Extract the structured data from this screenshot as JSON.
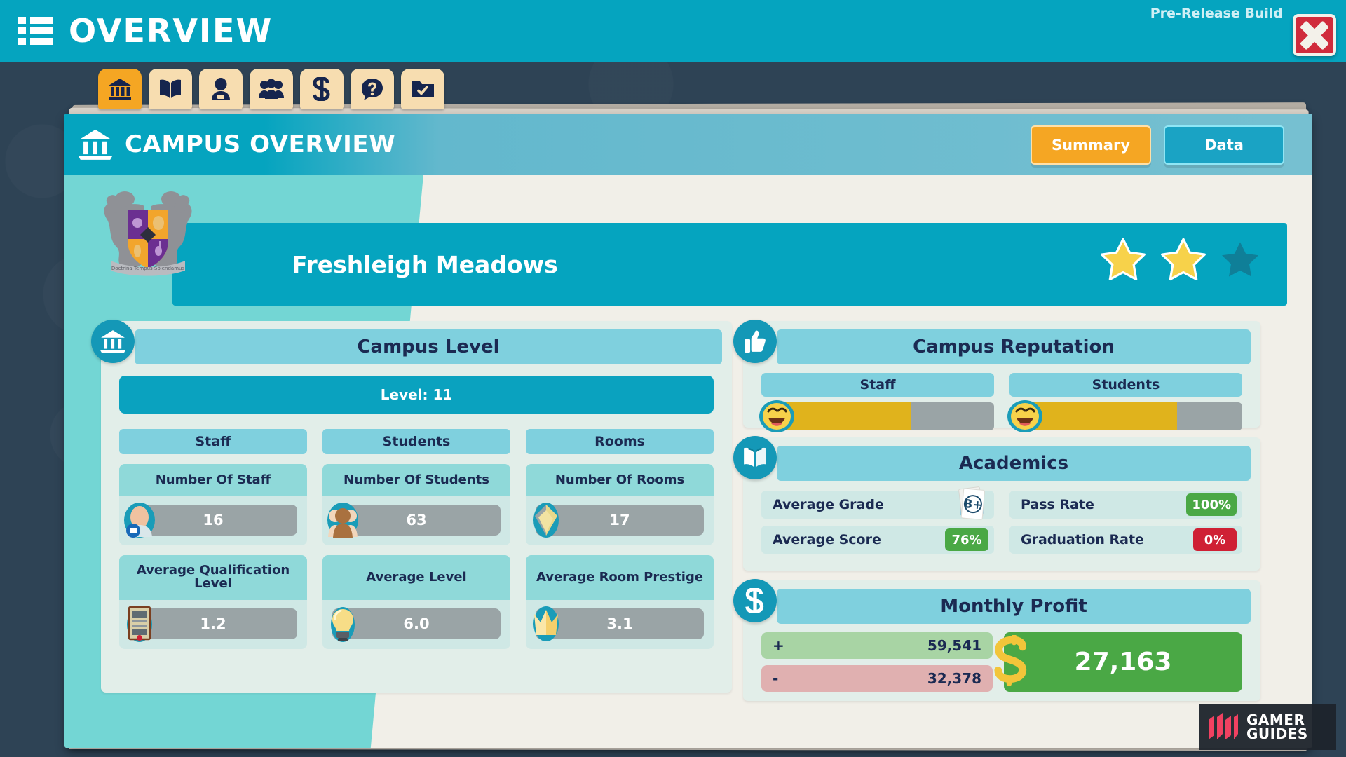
{
  "topbar": {
    "title": "OVERVIEW",
    "prerelease_label": "Pre-Release Build",
    "menu_icon": "list-icon",
    "close_icon": "close-x-icon"
  },
  "tabstrip": {
    "tabs": [
      {
        "name": "campus",
        "icon": "bank-icon",
        "active": true
      },
      {
        "name": "courses",
        "icon": "open-book-icon",
        "active": false
      },
      {
        "name": "staff",
        "icon": "staff-person-icon",
        "active": false
      },
      {
        "name": "students",
        "icon": "students-group-icon",
        "active": false
      },
      {
        "name": "finance",
        "icon": "dollar-icon",
        "active": false
      },
      {
        "name": "help",
        "icon": "question-bubble-icon",
        "active": false
      },
      {
        "name": "objectives",
        "icon": "folder-check-icon",
        "active": false
      }
    ]
  },
  "window": {
    "header": {
      "icon": "bank-icon",
      "title": "CAMPUS OVERVIEW",
      "tabs": [
        {
          "label": "Summary",
          "selected": true
        },
        {
          "label": "Data",
          "selected": false
        }
      ]
    },
    "banner": {
      "crest_icon": "campus-crest-icon",
      "campus_name": "Freshleigh Meadows",
      "stars_total": 3,
      "stars_filled": 2
    },
    "campus_level": {
      "panel_icon": "bank-icon",
      "title": "Campus Level",
      "level_label": "Level: 11",
      "columns": [
        "Staff",
        "Students",
        "Rooms"
      ],
      "stats": [
        {
          "title": "Number Of Staff",
          "value": "16",
          "icon": "staff-avatar-icon",
          "two_line": false
        },
        {
          "title": "Number Of Students",
          "value": "63",
          "icon": "students-avatar-icon",
          "two_line": false
        },
        {
          "title": "Number Of Rooms",
          "value": "17",
          "icon": "room-gem-icon",
          "two_line": false
        },
        {
          "title": "Average Qualification Level",
          "value": "1.2",
          "icon": "certificate-icon",
          "two_line": true
        },
        {
          "title": "Average Level",
          "value": "6.0",
          "icon": "lightbulb-icon",
          "two_line": true
        },
        {
          "title": "Average Room Prestige",
          "value": "3.1",
          "icon": "crown-icon",
          "two_line": true
        }
      ]
    },
    "reputation": {
      "panel_icon": "thumbs-up-icon",
      "title": "Campus Reputation",
      "bars": [
        {
          "label": "Staff",
          "percent": 62,
          "face_icon": "happy-face-icon"
        },
        {
          "label": "Students",
          "percent": 70,
          "face_icon": "happy-face-icon"
        }
      ]
    },
    "academics": {
      "panel_icon": "open-book-icon",
      "title": "Academics",
      "items": [
        {
          "label": "Average Grade",
          "value": "B+",
          "kind": "grade-card",
          "icon": "grade-card-icon"
        },
        {
          "label": "Pass Rate",
          "value": "100%",
          "kind": "pill-green"
        },
        {
          "label": "Average Score",
          "value": "76%",
          "kind": "pill-green"
        },
        {
          "label": "Graduation Rate",
          "value": "0%",
          "kind": "pill-red"
        }
      ]
    },
    "monthly_profit": {
      "panel_icon": "dollar-icon",
      "title": "Monthly Profit",
      "income_sign": "+",
      "income": "59,541",
      "expense_sign": "-",
      "expense": "32,378",
      "total": "27,163",
      "coin_icon": "dollar-coin-icon"
    }
  },
  "watermark": {
    "line1": "GAMER",
    "line2": "GUIDES",
    "logo_icon": "gamer-guides-logo-icon"
  },
  "colors": {
    "teal": "#05a4bf",
    "teal_light": "#7fd0de",
    "panel_bg": "#e2eee9",
    "orange": "#f5a623",
    "green": "#4aa845",
    "red": "#cf2034",
    "gold": "#e0b31c",
    "grey_track": "#9aa4a6",
    "dark_bg": "#2e4355",
    "navy_text": "#1b2a52"
  }
}
